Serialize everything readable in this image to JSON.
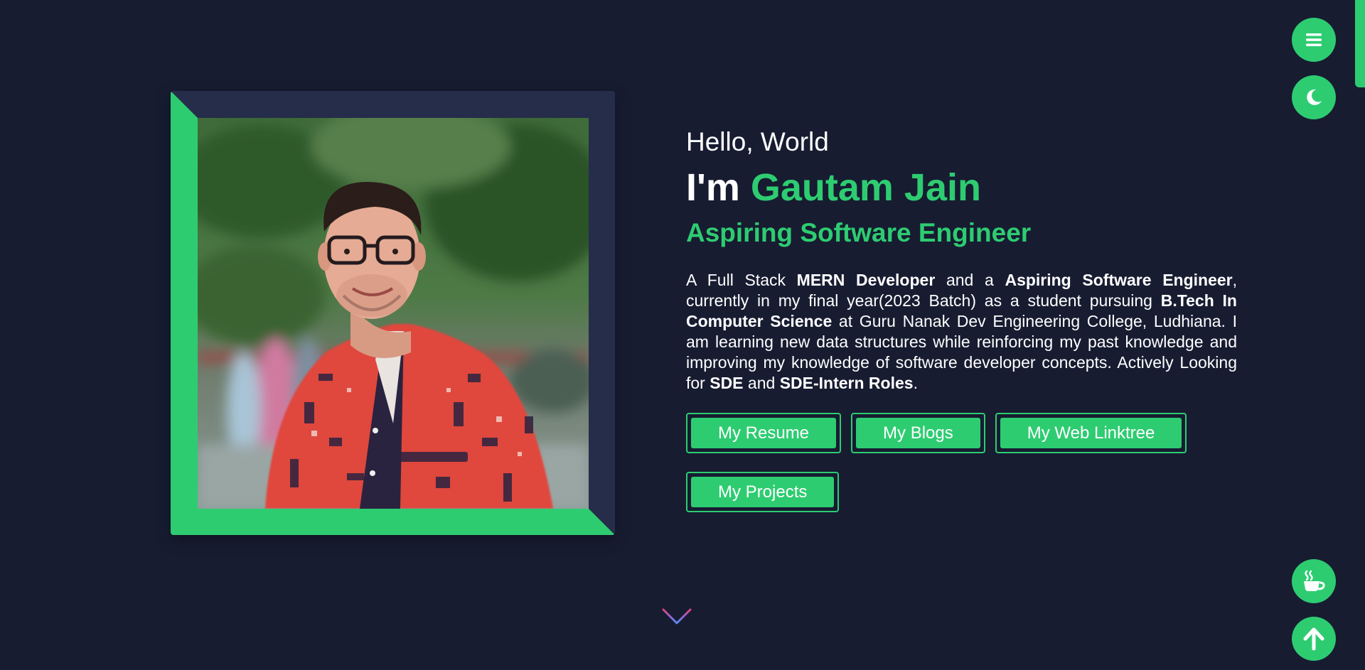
{
  "hero": {
    "greeting": "Hello, World",
    "name_prefix": "I'm ",
    "name": "Gautam Jain",
    "role": "Aspiring Software Engineer",
    "bio": [
      {
        "t": "A Full Stack ",
        "b": false
      },
      {
        "t": "MERN Developer",
        "b": true
      },
      {
        "t": " and a ",
        "b": false
      },
      {
        "t": "Aspiring Software Engineer",
        "b": true
      },
      {
        "t": ", currently in my final year(2023 Batch) as a student pursuing ",
        "b": false
      },
      {
        "t": "B.Tech In Computer Science",
        "b": true
      },
      {
        "t": " at Guru Nanak Dev Engineering College, Ludhiana. I am learning new data structures while reinforcing my past knowledge and improving my knowledge of software developer concepts. Actively Looking for ",
        "b": false
      },
      {
        "t": "SDE",
        "b": true
      },
      {
        "t": " and ",
        "b": false
      },
      {
        "t": "SDE-Intern Roles",
        "b": true
      },
      {
        "t": ".",
        "b": false
      }
    ],
    "buttons": {
      "resume": "My Resume",
      "blogs": "My Blogs",
      "linktree": "My Web Linktree",
      "projects": "My Projects"
    }
  },
  "icons": {
    "menu": "hamburger-menu-icon",
    "theme": "moon-icon",
    "coffee": "coffee-cup-icon",
    "top": "arrow-up-icon",
    "scroll": "arrow-down-icon"
  },
  "colors": {
    "background": "#171c31",
    "frame": "#252d4a",
    "accent": "#2ecc71",
    "text": "#ffffff"
  }
}
